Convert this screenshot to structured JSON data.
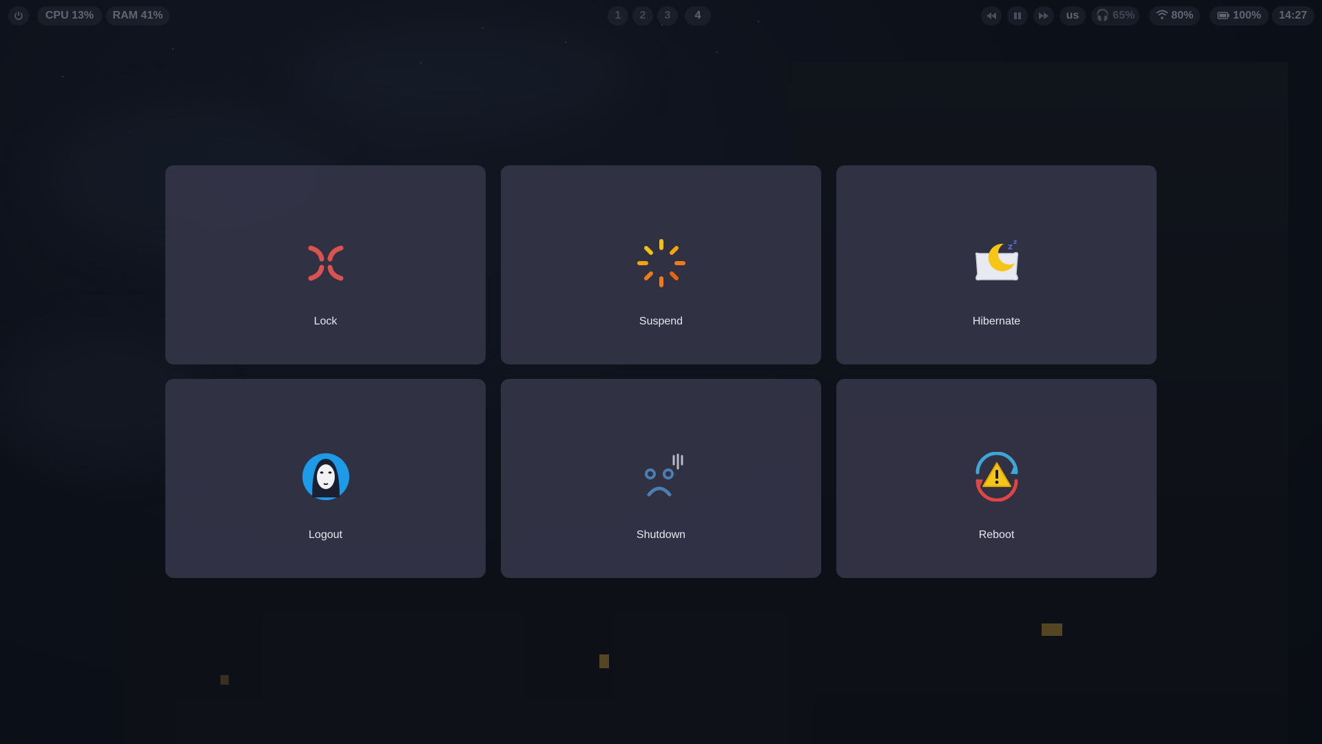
{
  "topbar": {
    "power_icon": "power-icon",
    "cpu": "CPU 13%",
    "ram": "RAM 41%",
    "workspaces": [
      "1",
      "2",
      "3",
      "4"
    ],
    "tray_icons": [
      "media-prev-icon",
      "media-play-icon",
      "media-next-icon"
    ],
    "keyboard_layout": "us",
    "volume": "65%",
    "wifi": "80%",
    "battery": "100%",
    "clock": "14:27"
  },
  "menu": {
    "items": [
      {
        "label": "Lock",
        "icon": "lock-anger-icon"
      },
      {
        "label": "Suspend",
        "icon": "suspend-sparkle-icon"
      },
      {
        "label": "Hibernate",
        "icon": "hibernate-moon-pillow-icon"
      },
      {
        "label": "Logout",
        "icon": "logout-mask-icon"
      },
      {
        "label": "Shutdown",
        "icon": "shutdown-face-icon"
      },
      {
        "label": "Reboot",
        "icon": "reboot-warning-icon"
      }
    ]
  },
  "colors": {
    "card_bg": "#343448",
    "label": "#e6e6ee",
    "lock_red": "#d9534f",
    "suspend_yellow": "#f4c20d",
    "suspend_orange": "#f07a1a",
    "logout_blue": "#1e9be8",
    "shutdown_blue": "#4a7fb0",
    "reboot_yellow": "#f5c518"
  }
}
